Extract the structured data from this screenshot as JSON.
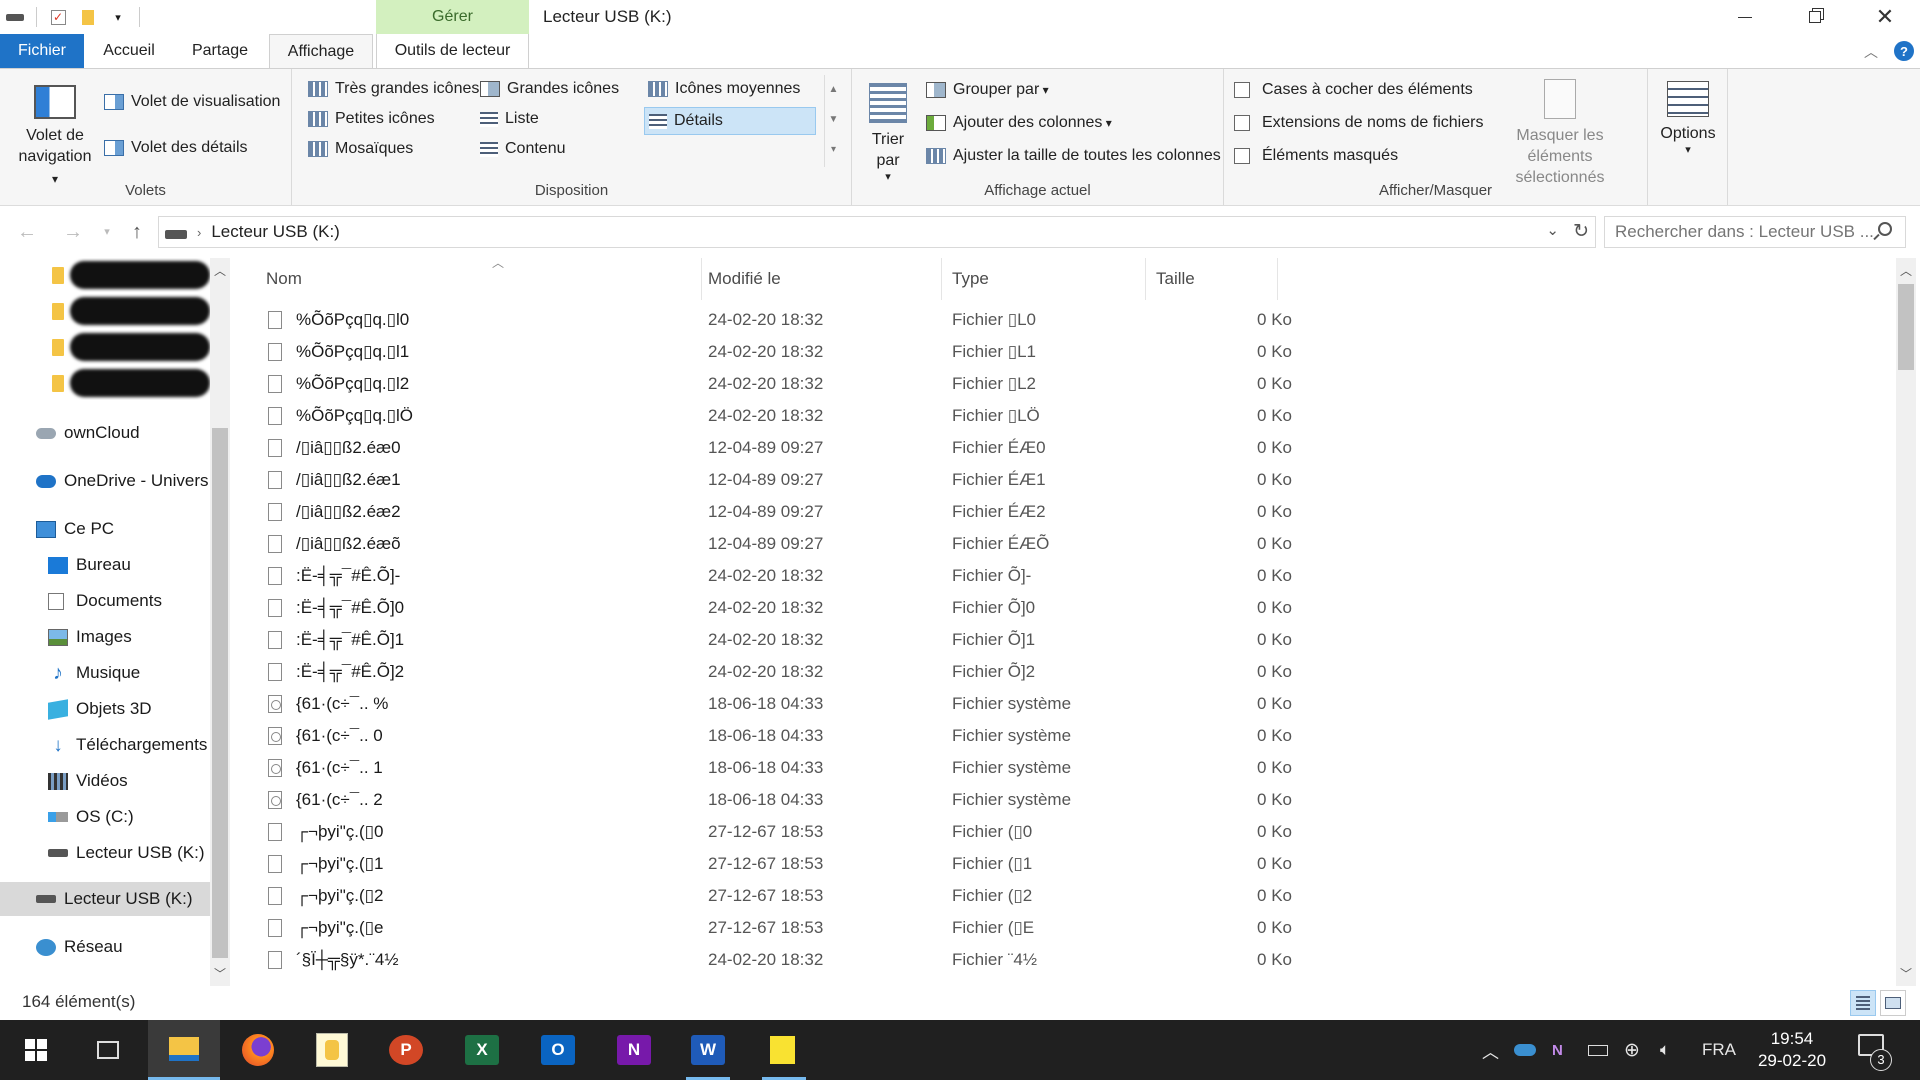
{
  "window": {
    "title": "Lecteur USB (K:)",
    "context_tab_group": "Gérer"
  },
  "ribbon_tabs": [
    "Fichier",
    "Accueil",
    "Partage",
    "Affichage",
    "Outils de lecteur"
  ],
  "ribbon": {
    "volets": {
      "label": "Volets",
      "nav_pane": "Volet de navigation",
      "preview_pane": "Volet de visualisation",
      "details_pane": "Volet des détails"
    },
    "disposition": {
      "label": "Disposition",
      "items": [
        "Très grandes icônes",
        "Grandes icônes",
        "Icônes moyennes",
        "Petites icônes",
        "Liste",
        "Détails",
        "Mosaïques",
        "Contenu"
      ],
      "selected": "Détails"
    },
    "affichage_actuel": {
      "label": "Affichage actuel",
      "sort": "Trier par",
      "group": "Grouper par",
      "add_columns": "Ajouter des colonnes",
      "fit_columns": "Ajuster la taille de toutes les colonnes"
    },
    "afficher_masquer": {
      "label": "Afficher/Masquer",
      "checkbox_items": "Cases à cocher des éléments",
      "extensions": "Extensions de noms de fichiers",
      "hidden_items": "Éléments masqués",
      "hide_selected": "Masquer les éléments sélectionnés"
    },
    "options": "Options"
  },
  "address": {
    "path": "Lecteur USB (K:)",
    "search_placeholder": "Rechercher dans : Lecteur USB ..."
  },
  "nav_pane": {
    "items": [
      "ownCloud",
      "OneDrive - Univers",
      "Ce PC",
      "Bureau",
      "Documents",
      "Images",
      "Musique",
      "Objets 3D",
      "Téléchargements",
      "Vidéos",
      "OS (C:)",
      "Lecteur USB (K:)",
      "Lecteur USB (K:)",
      "Réseau"
    ]
  },
  "columns": [
    "Nom",
    "Modifié le",
    "Type",
    "Taille"
  ],
  "files": [
    {
      "name": "%ÕõPçq▯q.▯l0",
      "date": "24-02-20 18:32",
      "type": "Fichier ▯L0",
      "size": "0 Ko",
      "icon": "file"
    },
    {
      "name": "%ÕõPçq▯q.▯l1",
      "date": "24-02-20 18:32",
      "type": "Fichier ▯L1",
      "size": "0 Ko",
      "icon": "file"
    },
    {
      "name": "%ÕõPçq▯q.▯l2",
      "date": "24-02-20 18:32",
      "type": "Fichier ▯L2",
      "size": "0 Ko",
      "icon": "file"
    },
    {
      "name": "%ÕõPçq▯q.▯lÖ",
      "date": "24-02-20 18:32",
      "type": "Fichier ▯LÖ",
      "size": "0 Ko",
      "icon": "file"
    },
    {
      "name": "/▯iâ▯▯ß2.éæ0",
      "date": "12-04-89 09:27",
      "type": "Fichier ÉÆ0",
      "size": "0 Ko",
      "icon": "file"
    },
    {
      "name": "/▯iâ▯▯ß2.éæ1",
      "date": "12-04-89 09:27",
      "type": "Fichier ÉÆ1",
      "size": "0 Ko",
      "icon": "file"
    },
    {
      "name": "/▯iâ▯▯ß2.éæ2",
      "date": "12-04-89 09:27",
      "type": "Fichier ÉÆ2",
      "size": "0 Ko",
      "icon": "file"
    },
    {
      "name": "/▯iâ▯▯ß2.éæõ",
      "date": "12-04-89 09:27",
      "type": "Fichier ÉÆÕ",
      "size": "0 Ko",
      "icon": "file"
    },
    {
      "name": ":Ë-╡╦¯#Ê.Õ]-",
      "date": "24-02-20 18:32",
      "type": "Fichier Õ]-",
      "size": "0 Ko",
      "icon": "file"
    },
    {
      "name": ":Ë-╡╦¯#Ê.Õ]0",
      "date": "24-02-20 18:32",
      "type": "Fichier Õ]0",
      "size": "0 Ko",
      "icon": "file"
    },
    {
      "name": ":Ë-╡╦¯#Ê.Õ]1",
      "date": "24-02-20 18:32",
      "type": "Fichier Õ]1",
      "size": "0 Ko",
      "icon": "file"
    },
    {
      "name": ":Ë-╡╦¯#Ê.Õ]2",
      "date": "24-02-20 18:32",
      "type": "Fichier Õ]2",
      "size": "0 Ko",
      "icon": "file"
    },
    {
      "name": "{61·(c÷¯.. %",
      "date": "18-06-18 04:33",
      "type": "Fichier système",
      "size": "0 Ko",
      "icon": "system"
    },
    {
      "name": "{61·(c÷¯.. 0",
      "date": "18-06-18 04:33",
      "type": "Fichier système",
      "size": "0 Ko",
      "icon": "system"
    },
    {
      "name": "{61·(c÷¯.. 1",
      "date": "18-06-18 04:33",
      "type": "Fichier système",
      "size": "0 Ko",
      "icon": "system"
    },
    {
      "name": "{61·(c÷¯.. 2",
      "date": "18-06-18 04:33",
      "type": "Fichier système",
      "size": "0 Ko",
      "icon": "system"
    },
    {
      "name": "┌¬þyi\"ç.(▯0",
      "date": "27-12-67 18:53",
      "type": "Fichier (▯0",
      "size": "0 Ko",
      "icon": "file"
    },
    {
      "name": "┌¬þyi\"ç.(▯1",
      "date": "27-12-67 18:53",
      "type": "Fichier (▯1",
      "size": "0 Ko",
      "icon": "file"
    },
    {
      "name": "┌¬þyi\"ç.(▯2",
      "date": "27-12-67 18:53",
      "type": "Fichier (▯2",
      "size": "0 Ko",
      "icon": "file"
    },
    {
      "name": "┌¬þyi\"ç.(▯e",
      "date": "27-12-67 18:53",
      "type": "Fichier (▯E",
      "size": "0 Ko",
      "icon": "file"
    },
    {
      "name": "´§Ï┼╦§ÿ*.¨4½",
      "date": "24-02-20 18:32",
      "type": "Fichier ¨4½",
      "size": "0 Ko",
      "icon": "file"
    }
  ],
  "status": {
    "count": "164 élément(s)"
  },
  "taskbar": {
    "language": "FRA",
    "time": "19:54",
    "date": "29-02-20",
    "notifications": "3"
  },
  "colors": {
    "accent": "#1f73c7",
    "context_tab": "#d3f0bf",
    "selection": "#cce4f7",
    "taskbar": "#202020"
  }
}
